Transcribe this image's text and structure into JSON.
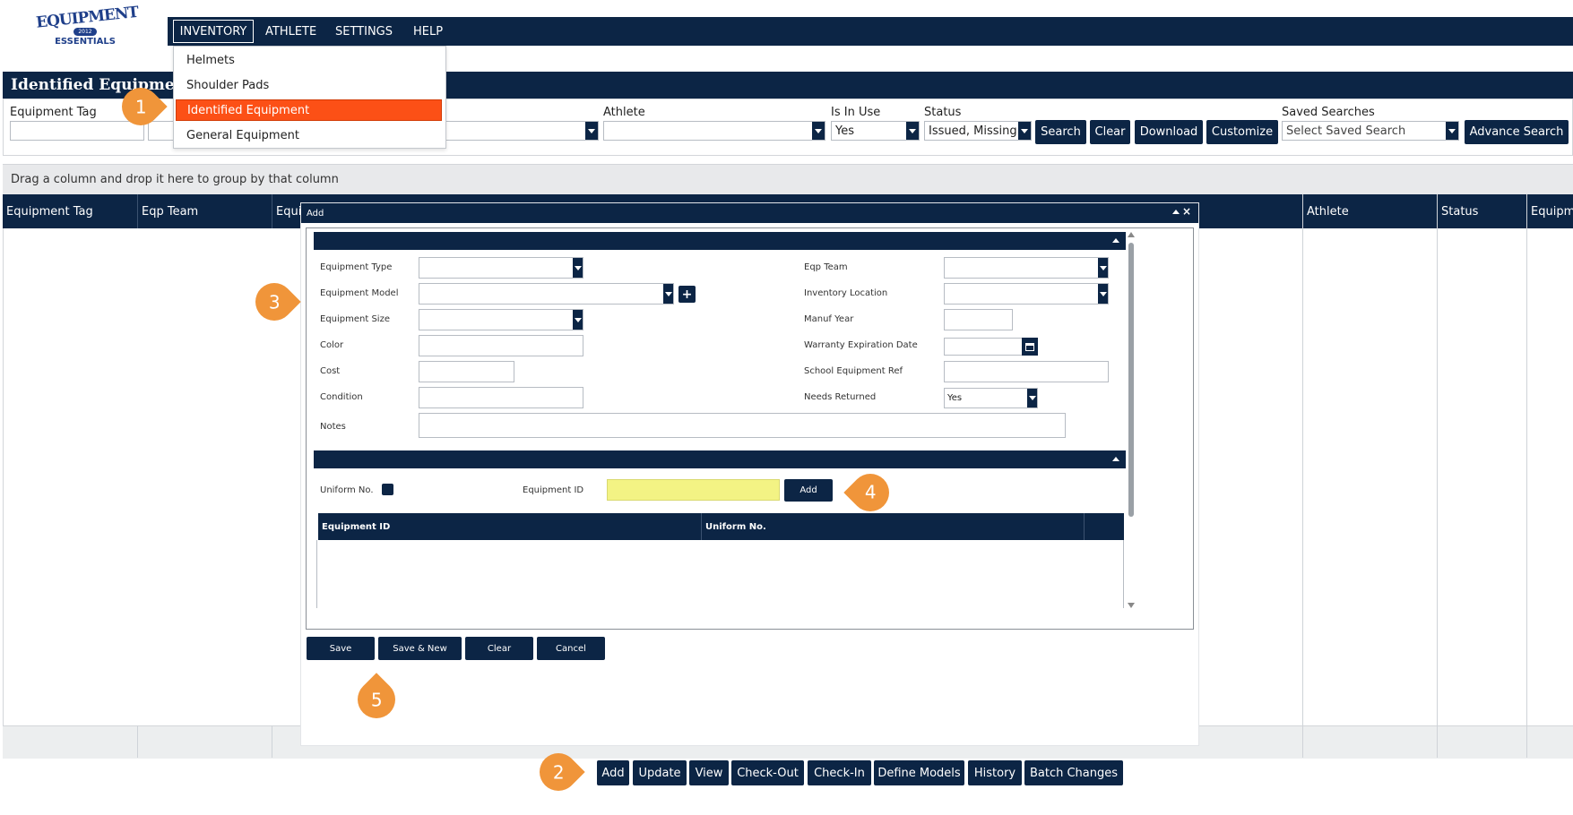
{
  "logo": {
    "word1": "EQUIPMENT",
    "year": "2012",
    "word2": "ESSENTIALS"
  },
  "nav": {
    "items": [
      "INVENTORY",
      "ATHLETE",
      "SETTINGS",
      "HELP"
    ]
  },
  "inventory_menu": {
    "items": [
      "Helmets",
      "Shoulder Pads",
      "Identified Equipment",
      "General Equipment"
    ],
    "selected": "Identified Equipment"
  },
  "page": {
    "title": "Identified Equipment"
  },
  "filters": {
    "equipment_tag_label": "Equipment Tag",
    "athlete_label": "Athlete",
    "is_in_use_label": "Is In Use",
    "is_in_use_value": "Yes",
    "status_label": "Status",
    "status_value": "Issued, Missing",
    "saved_searches_label": "Saved Searches",
    "saved_searches_placeholder": "Select Saved Search",
    "buttons": [
      "Search",
      "Clear",
      "Download",
      "Customize"
    ],
    "advance_search": "Advance Search"
  },
  "grid": {
    "group_hint": "Drag a column and drop it here to group by that column",
    "columns": [
      "Equipment Tag",
      "Eqp Team",
      "Equi",
      "Athlete",
      "Status",
      "Equipm"
    ]
  },
  "bottom_buttons": [
    "Add",
    "Update",
    "View",
    "Check-Out",
    "Check-In",
    "Define Models",
    "History",
    "Batch Changes"
  ],
  "modal": {
    "title": "Add",
    "left_fields": [
      "Equipment Type",
      "Equipment Model",
      "Equipment Size",
      "Color",
      "Cost",
      "Condition",
      "Notes"
    ],
    "right_fields": [
      "Eqp Team",
      "Inventory Location",
      "Manuf Year",
      "Warranty Expiration Date",
      "School Equipment Ref",
      "Needs Returned"
    ],
    "needs_returned_value": "Yes",
    "uniform_no_label": "Uniform No.",
    "equipment_id_label": "Equipment ID",
    "add_label": "Add",
    "sub_columns": [
      "Equipment ID",
      "Uniform No."
    ],
    "buttons": [
      "Save",
      "Save & New",
      "Clear",
      "Cancel"
    ]
  },
  "markers": [
    "1",
    "2",
    "3",
    "4",
    "5"
  ],
  "colors": {
    "navy": "#0c2545",
    "accent": "#fc5016",
    "marker": "#f0953a",
    "highlight": "#f3f384"
  }
}
